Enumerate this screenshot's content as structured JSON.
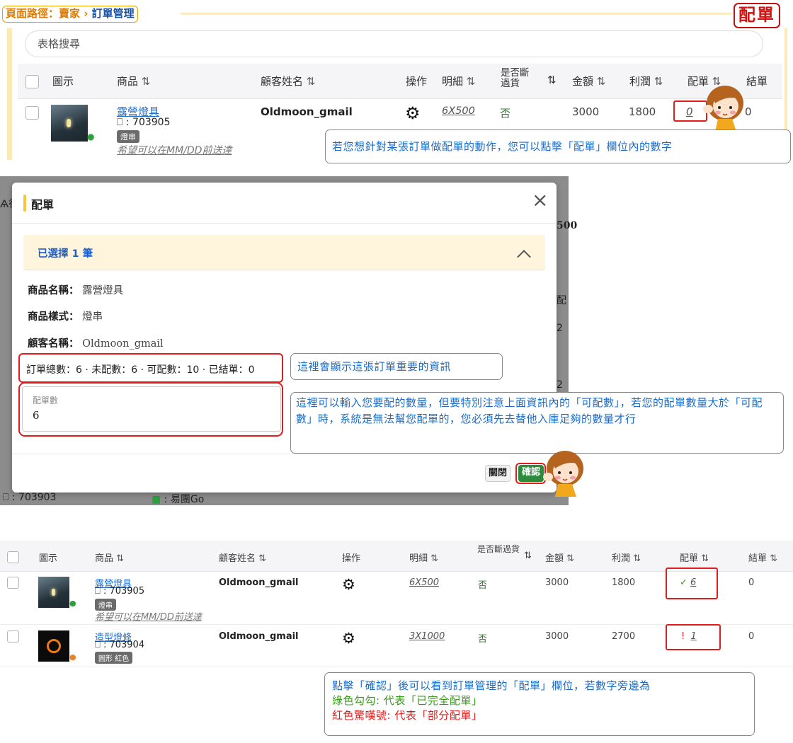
{
  "breadcrumb": {
    "prefix": "頁面路徑：賣家",
    "sep": "›",
    "current": "訂單管理"
  },
  "badge": "配單",
  "search": {
    "placeholder": "表格搜尋"
  },
  "table1": {
    "headers": {
      "icon": "圖示",
      "product": "商品",
      "customer": "顧客姓名",
      "action": "操作",
      "detail": "明細",
      "backorder": "是否斷過貨",
      "amount": "金額",
      "profit": "利潤",
      "allocate": "配單",
      "settle": "結單"
    },
    "sort_glyph": "⇅",
    "row": {
      "product": "露營燈具",
      "code": "703905",
      "tag": "燈串",
      "remark": "希望可以在MM/DD前送達",
      "customer": "Oldmoon_gmail",
      "detail": "6X500",
      "backorder": "否",
      "amount": "3000",
      "profit": "1800",
      "allocate": "0",
      "settle": "0"
    }
  },
  "note1": "若您想針對某張訂單做配單的動作，您可以點擊「配單」欄位內的數字",
  "modal": {
    "title": "配單",
    "close": "×",
    "selected": "已選擇 1 筆",
    "product_name_label": "商品名稱：",
    "product_name": "露營燈具",
    "product_style_label": "商品樣式：",
    "product_style": "燈串",
    "customer_label": "顧客名稱：",
    "customer": "Oldmoon_gmail",
    "summary": "訂單總數：6 · 未配數：6 · 可配數：10 · 已結單：0",
    "qty_label": "配單數",
    "qty_value": "6",
    "close_button": "關閉",
    "confirm_button": "確認",
    "bg_left": "Ѧ行",
    "bg_code": "703903",
    "bg_line": "易團Go",
    "bg_500": "500",
    "bg_allocate": "配",
    "bg_2a": "2",
    "bg_2b": "2"
  },
  "note2": "這裡會顯示這張訂單重要的資訊",
  "note3": "這裡可以輸入您要配的數量，但要特別注意上面資訊內的「可配數」，若您的配單數量大於「可配數」時，系統是無法幫您配單的，您必須先去替他入庫足夠的數量才行",
  "table3": {
    "headers": {
      "icon": "圖示",
      "product": "商品",
      "customer": "顧客姓名",
      "action": "操作",
      "detail": "明細",
      "backorder": "是否斷過貨",
      "amount": "金額",
      "profit": "利潤",
      "allocate": "配單",
      "settle": "結單"
    },
    "rows": [
      {
        "product": "露營燈具",
        "code": "703905",
        "tag": "燈串",
        "remark": "希望可以在MM/DD前送達",
        "customer": "Oldmoon_gmail",
        "detail": "6X500",
        "backorder": "否",
        "amount": "3000",
        "profit": "1800",
        "allocate_mark": "✓",
        "allocate": "6",
        "settle": "0"
      },
      {
        "product": "造型燈條",
        "code": "703904",
        "tag": "圓形 紅色",
        "customer": "Oldmoon_gmail",
        "detail": "3X1000",
        "backorder": "否",
        "amount": "3000",
        "profit": "2700",
        "allocate_mark": "!",
        "allocate": "1",
        "settle": "0"
      }
    ]
  },
  "note4": {
    "line1": "點擊「確認」後可以看到訂單管理的「配單」欄位，若數字旁邊為",
    "line2": "綠色勾勾: 代表「已完全配單」",
    "line3": "紅色驚嘆號: 代表「部分配單」",
    "color_green": "#3a9a1a",
    "color_red": "#e01d1d",
    "color_blue": "#1a6cc9"
  },
  "icons": [
    "bookmark-icon",
    "gear-icon",
    "close-icon",
    "chevron-up-icon",
    "person-icon",
    "line-icon",
    "mascot-icon"
  ]
}
